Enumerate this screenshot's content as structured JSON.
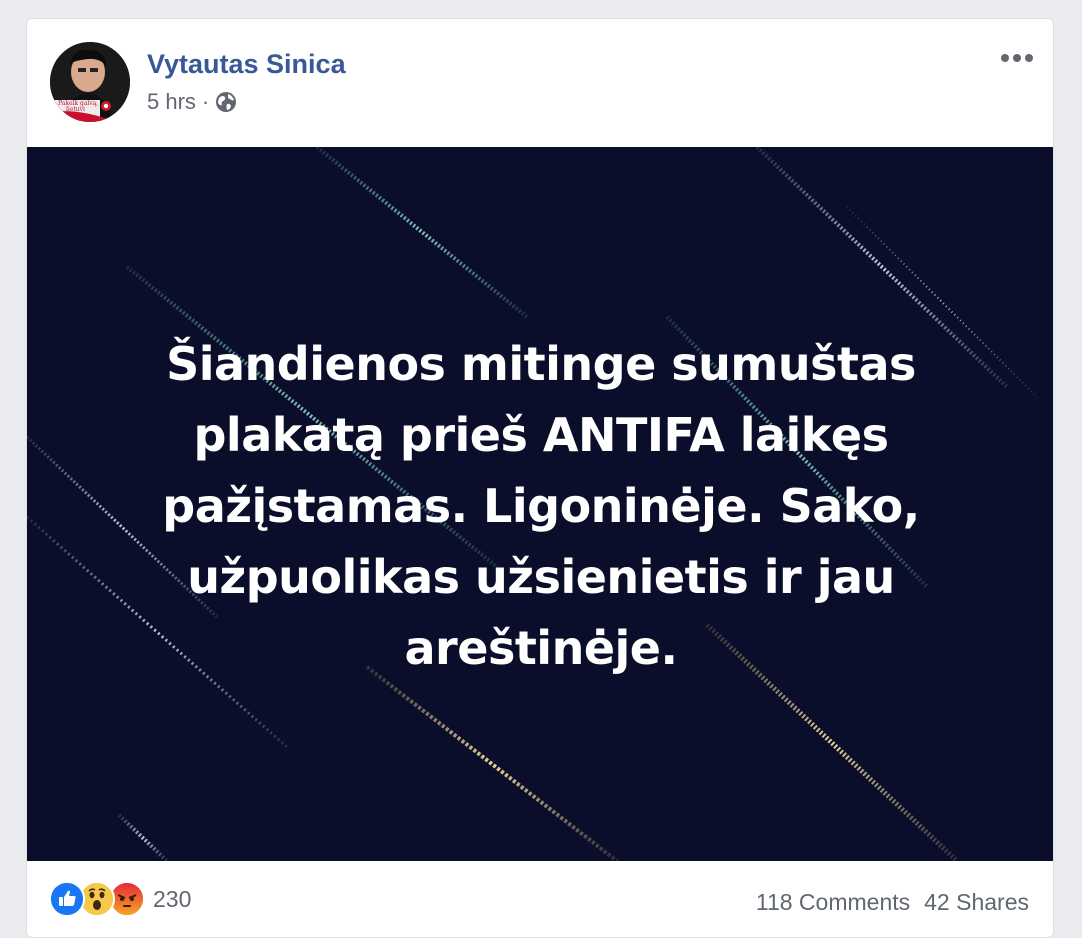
{
  "post": {
    "author": "Vytautas Sinica",
    "timestamp": "5 hrs",
    "separator": "·",
    "privacy_icon": "globe-icon",
    "menu_icon": "more-options-icon",
    "avatar_caption_lines": [
      "Pakelk galvą,",
      "lietuvi"
    ],
    "image_text_lines": [
      "Šiandienos mitinge sumuštas",
      "plakatą prieš ANTIFA laikęs",
      "pažįstamas. Ligoninėje. Sako,",
      "užpuolikas užsienietis ir jau",
      "areštinėje."
    ]
  },
  "footer": {
    "reactions": [
      "like-icon",
      "wow-icon",
      "angry-icon"
    ],
    "reaction_count": "230",
    "comments": "118 Comments",
    "shares": "42 Shares"
  },
  "colors": {
    "author_link": "#385898",
    "image_bg": "#0b0e2a",
    "like_blue": "#1877f2",
    "angry_red": "#e9710f"
  }
}
